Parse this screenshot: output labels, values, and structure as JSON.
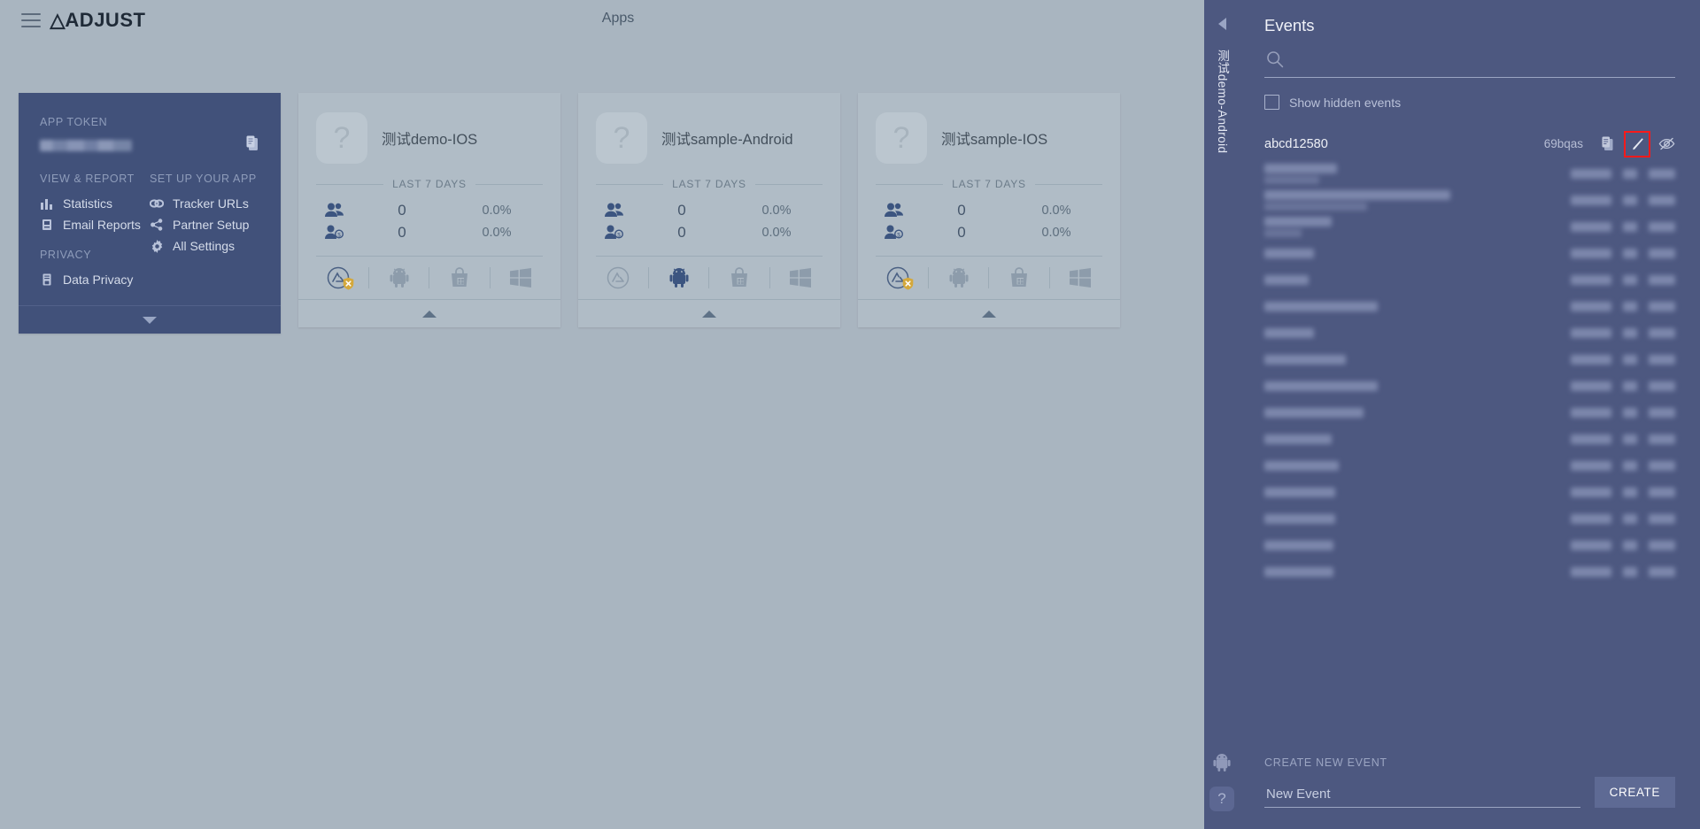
{
  "header": {
    "logo": "ADJUST",
    "page_title": "Apps",
    "menu_icon": "hamburger-icon"
  },
  "token_card": {
    "app_token_label": "APP TOKEN",
    "token_value_redacted": true,
    "copy_icon": "clipboard-icon",
    "view_report_label": "VIEW & REPORT",
    "setup_label": "SET UP YOUR APP",
    "privacy_label": "PRIVACY",
    "view_report_items": [
      {
        "label": "Statistics",
        "icon": "bar-chart-icon"
      },
      {
        "label": "Email Reports",
        "icon": "email-report-icon"
      }
    ],
    "privacy_items": [
      {
        "label": "Data Privacy",
        "icon": "document-lock-icon"
      }
    ],
    "setup_items": [
      {
        "label": "Tracker URLs",
        "icon": "link-icon"
      },
      {
        "label": "Partner Setup",
        "icon": "share-nodes-icon"
      },
      {
        "label": "All Settings",
        "icon": "gear-icon"
      }
    ]
  },
  "apps": [
    {
      "name": "测试demo-IOS",
      "icon_placeholder": "?",
      "period_label": "LAST 7 DAYS",
      "stats": [
        {
          "icon": "users-icon",
          "value": "0",
          "percent": "0.0%"
        },
        {
          "icon": "paying-user-icon",
          "value": "0",
          "percent": "0.0%"
        }
      ],
      "platforms": [
        {
          "icon": "app-store-icon",
          "active": true,
          "badge": "warning-shield-icon"
        },
        {
          "icon": "android-icon",
          "active": false,
          "badge": ""
        },
        {
          "icon": "windows-store-icon",
          "active": false,
          "badge": ""
        },
        {
          "icon": "windows-icon",
          "active": false,
          "badge": ""
        }
      ]
    },
    {
      "name": "测试sample-Android",
      "icon_placeholder": "?",
      "period_label": "LAST 7 DAYS",
      "stats": [
        {
          "icon": "users-icon",
          "value": "0",
          "percent": "0.0%"
        },
        {
          "icon": "paying-user-icon",
          "value": "0",
          "percent": "0.0%"
        }
      ],
      "platforms": [
        {
          "icon": "app-store-icon",
          "active": false,
          "badge": ""
        },
        {
          "icon": "android-icon",
          "active": true,
          "badge": ""
        },
        {
          "icon": "windows-store-icon",
          "active": false,
          "badge": ""
        },
        {
          "icon": "windows-icon",
          "active": false,
          "badge": ""
        }
      ]
    },
    {
      "name": "测试sample-IOS",
      "icon_placeholder": "?",
      "period_label": "LAST 7 DAYS",
      "stats": [
        {
          "icon": "users-icon",
          "value": "0",
          "percent": "0.0%"
        },
        {
          "icon": "paying-user-icon",
          "value": "0",
          "percent": "0.0%"
        }
      ],
      "platforms": [
        {
          "icon": "app-store-icon",
          "active": true,
          "badge": "warning-shield-icon"
        },
        {
          "icon": "android-icon",
          "active": false,
          "badge": ""
        },
        {
          "icon": "windows-store-icon",
          "active": false,
          "badge": ""
        },
        {
          "icon": "windows-icon",
          "active": false,
          "badge": ""
        }
      ]
    }
  ],
  "side_strip": {
    "collapse_icon": "chevron-left-icon",
    "app_label": "测试demo-Android",
    "bottom_icons": [
      {
        "name": "android-icon"
      },
      {
        "name": "app-placeholder-icon",
        "glyph": "?"
      }
    ]
  },
  "events": {
    "title": "Events",
    "search_value": "",
    "search_placeholder": "",
    "search_icon": "search-icon",
    "show_hidden_label": "Show hidden events",
    "show_hidden_checked": false,
    "rows": [
      {
        "name": "abcd12580",
        "token": "69bqas",
        "redacted": false,
        "actions": [
          {
            "icon": "clipboard-icon",
            "highlighted": false
          },
          {
            "icon": "edit-pencil-icon",
            "highlighted": true
          },
          {
            "icon": "eye-slash-icon",
            "highlighted": false
          }
        ]
      },
      {
        "name": "",
        "token": "",
        "redacted": true,
        "w1": 82,
        "w2": 62,
        "lines": 2
      },
      {
        "name": "",
        "token": "",
        "redacted": true,
        "w1": 210,
        "w2": 0,
        "lines": 2
      },
      {
        "name": "",
        "token": "",
        "redacted": true,
        "w1": 76,
        "w2": 0,
        "lines": 2
      },
      {
        "name": "",
        "token": "",
        "redacted": true,
        "w1": 56,
        "w2": 0,
        "lines": 1
      },
      {
        "name": "",
        "token": "",
        "redacted": true,
        "w1": 50,
        "w2": 0,
        "lines": 1
      },
      {
        "name": "",
        "token": "",
        "redacted": true,
        "w1": 128,
        "w2": 0,
        "lines": 1
      },
      {
        "name": "",
        "token": "",
        "redacted": true,
        "w1": 56,
        "w2": 0,
        "lines": 1
      },
      {
        "name": "",
        "token": "",
        "redacted": true,
        "w1": 92,
        "w2": 0,
        "lines": 1
      },
      {
        "name": "",
        "token": "",
        "redacted": true,
        "w1": 128,
        "w2": 0,
        "lines": 1
      },
      {
        "name": "",
        "token": "",
        "redacted": true,
        "w1": 112,
        "w2": 0,
        "lines": 1
      },
      {
        "name": "",
        "token": "",
        "redacted": true,
        "w1": 76,
        "w2": 0,
        "lines": 1
      },
      {
        "name": "",
        "token": "",
        "redacted": true,
        "w1": 84,
        "w2": 0,
        "lines": 1
      },
      {
        "name": "",
        "token": "",
        "redacted": true,
        "w1": 80,
        "w2": 0,
        "lines": 1
      },
      {
        "name": "",
        "token": "",
        "redacted": true,
        "w1": 80,
        "w2": 0,
        "lines": 1
      },
      {
        "name": "",
        "token": "",
        "redacted": true,
        "w1": 78,
        "w2": 0,
        "lines": 1
      },
      {
        "name": "",
        "token": "",
        "redacted": true,
        "w1": 78,
        "w2": 0,
        "lines": 1
      }
    ],
    "create_label": "CREATE NEW EVENT",
    "create_placeholder": "New Event",
    "create_value": "",
    "create_button": "CREATE"
  },
  "colors": {
    "page_bg": "#a9b5c0",
    "dark_panel": "#41517a",
    "events_panel": "#4d5880",
    "card_bg": "#b0bcc6",
    "accent_text": "#3c5580",
    "highlight_outline": "#ff1a1a",
    "badge_warning": "#d4a83c"
  }
}
